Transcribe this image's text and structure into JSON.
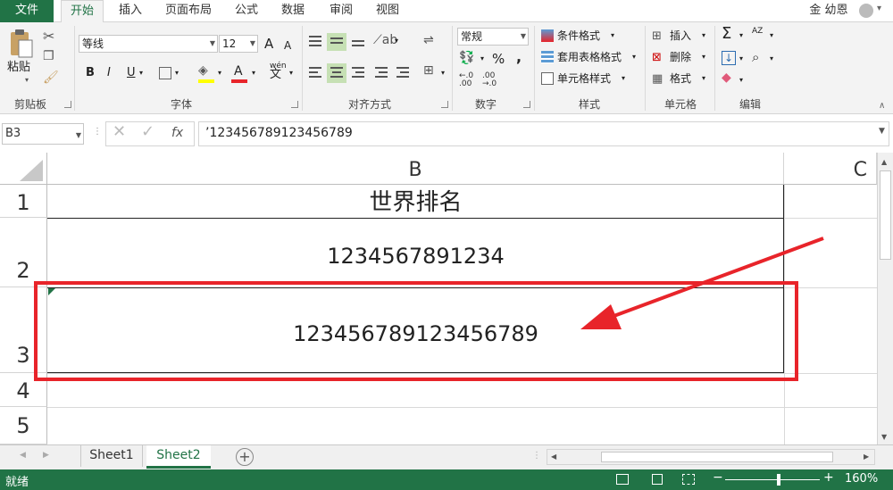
{
  "tabs": [
    "文件",
    "开始",
    "插入",
    "页面布局",
    "公式",
    "数据",
    "审阅",
    "视图"
  ],
  "user": "金 幼恩",
  "clipboard": {
    "paste": "粘贴",
    "label": "剪贴板"
  },
  "font": {
    "name": "等线",
    "size": "12",
    "label": "字体",
    "bold": "B",
    "italic": "I",
    "underline": "U",
    "wen": "wén",
    "wen2": "文",
    "grow": "A",
    "shrink": "A",
    "color": "A"
  },
  "align": {
    "label": "对齐方式"
  },
  "number": {
    "format": "常规",
    "percent": "%",
    "comma": ",",
    "inc": ".0\n.00",
    "dec": ".00\n.0",
    "label": "数字"
  },
  "styles": {
    "cond": "条件格式",
    "table": "套用表格格式",
    "cell": "单元格样式",
    "label": "样式"
  },
  "cells": {
    "insert": "插入",
    "delete": "删除",
    "format": "格式",
    "label": "单元格"
  },
  "editing": {
    "sum": "Σ",
    "sort": "AZ",
    "find": "",
    "label": "编辑"
  },
  "formula_bar": {
    "name_box": "B3",
    "fx": "fx",
    "content": "’123456789123456789"
  },
  "columns": [
    "B",
    "C"
  ],
  "rows": [
    "1",
    "2",
    "3",
    "4",
    "5"
  ],
  "cells_data": {
    "b1": "世界排名",
    "b2": "1234567891234",
    "b3": "123456789123456789"
  },
  "sheets": [
    "Sheet1",
    "Sheet2"
  ],
  "add_sheet": "+",
  "status": {
    "ready": "就绪",
    "zoom": "160%"
  },
  "colors": {
    "accent": "#217346",
    "highlight": "#e8242a"
  }
}
